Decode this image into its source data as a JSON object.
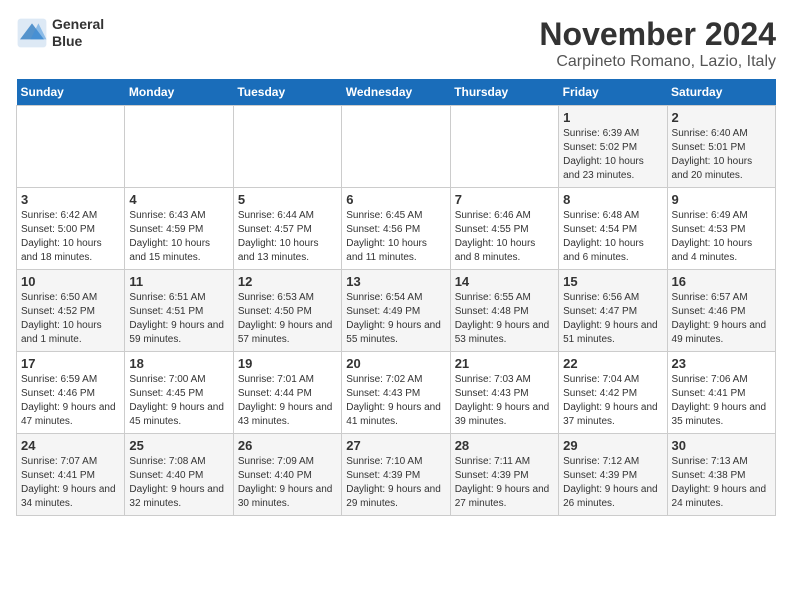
{
  "header": {
    "logo_line1": "General",
    "logo_line2": "Blue",
    "month": "November 2024",
    "location": "Carpineto Romano, Lazio, Italy"
  },
  "weekdays": [
    "Sunday",
    "Monday",
    "Tuesday",
    "Wednesday",
    "Thursday",
    "Friday",
    "Saturday"
  ],
  "weeks": [
    [
      {
        "day": "",
        "info": ""
      },
      {
        "day": "",
        "info": ""
      },
      {
        "day": "",
        "info": ""
      },
      {
        "day": "",
        "info": ""
      },
      {
        "day": "",
        "info": ""
      },
      {
        "day": "1",
        "info": "Sunrise: 6:39 AM\nSunset: 5:02 PM\nDaylight: 10 hours and 23 minutes."
      },
      {
        "day": "2",
        "info": "Sunrise: 6:40 AM\nSunset: 5:01 PM\nDaylight: 10 hours and 20 minutes."
      }
    ],
    [
      {
        "day": "3",
        "info": "Sunrise: 6:42 AM\nSunset: 5:00 PM\nDaylight: 10 hours and 18 minutes."
      },
      {
        "day": "4",
        "info": "Sunrise: 6:43 AM\nSunset: 4:59 PM\nDaylight: 10 hours and 15 minutes."
      },
      {
        "day": "5",
        "info": "Sunrise: 6:44 AM\nSunset: 4:57 PM\nDaylight: 10 hours and 13 minutes."
      },
      {
        "day": "6",
        "info": "Sunrise: 6:45 AM\nSunset: 4:56 PM\nDaylight: 10 hours and 11 minutes."
      },
      {
        "day": "7",
        "info": "Sunrise: 6:46 AM\nSunset: 4:55 PM\nDaylight: 10 hours and 8 minutes."
      },
      {
        "day": "8",
        "info": "Sunrise: 6:48 AM\nSunset: 4:54 PM\nDaylight: 10 hours and 6 minutes."
      },
      {
        "day": "9",
        "info": "Sunrise: 6:49 AM\nSunset: 4:53 PM\nDaylight: 10 hours and 4 minutes."
      }
    ],
    [
      {
        "day": "10",
        "info": "Sunrise: 6:50 AM\nSunset: 4:52 PM\nDaylight: 10 hours and 1 minute."
      },
      {
        "day": "11",
        "info": "Sunrise: 6:51 AM\nSunset: 4:51 PM\nDaylight: 9 hours and 59 minutes."
      },
      {
        "day": "12",
        "info": "Sunrise: 6:53 AM\nSunset: 4:50 PM\nDaylight: 9 hours and 57 minutes."
      },
      {
        "day": "13",
        "info": "Sunrise: 6:54 AM\nSunset: 4:49 PM\nDaylight: 9 hours and 55 minutes."
      },
      {
        "day": "14",
        "info": "Sunrise: 6:55 AM\nSunset: 4:48 PM\nDaylight: 9 hours and 53 minutes."
      },
      {
        "day": "15",
        "info": "Sunrise: 6:56 AM\nSunset: 4:47 PM\nDaylight: 9 hours and 51 minutes."
      },
      {
        "day": "16",
        "info": "Sunrise: 6:57 AM\nSunset: 4:46 PM\nDaylight: 9 hours and 49 minutes."
      }
    ],
    [
      {
        "day": "17",
        "info": "Sunrise: 6:59 AM\nSunset: 4:46 PM\nDaylight: 9 hours and 47 minutes."
      },
      {
        "day": "18",
        "info": "Sunrise: 7:00 AM\nSunset: 4:45 PM\nDaylight: 9 hours and 45 minutes."
      },
      {
        "day": "19",
        "info": "Sunrise: 7:01 AM\nSunset: 4:44 PM\nDaylight: 9 hours and 43 minutes."
      },
      {
        "day": "20",
        "info": "Sunrise: 7:02 AM\nSunset: 4:43 PM\nDaylight: 9 hours and 41 minutes."
      },
      {
        "day": "21",
        "info": "Sunrise: 7:03 AM\nSunset: 4:43 PM\nDaylight: 9 hours and 39 minutes."
      },
      {
        "day": "22",
        "info": "Sunrise: 7:04 AM\nSunset: 4:42 PM\nDaylight: 9 hours and 37 minutes."
      },
      {
        "day": "23",
        "info": "Sunrise: 7:06 AM\nSunset: 4:41 PM\nDaylight: 9 hours and 35 minutes."
      }
    ],
    [
      {
        "day": "24",
        "info": "Sunrise: 7:07 AM\nSunset: 4:41 PM\nDaylight: 9 hours and 34 minutes."
      },
      {
        "day": "25",
        "info": "Sunrise: 7:08 AM\nSunset: 4:40 PM\nDaylight: 9 hours and 32 minutes."
      },
      {
        "day": "26",
        "info": "Sunrise: 7:09 AM\nSunset: 4:40 PM\nDaylight: 9 hours and 30 minutes."
      },
      {
        "day": "27",
        "info": "Sunrise: 7:10 AM\nSunset: 4:39 PM\nDaylight: 9 hours and 29 minutes."
      },
      {
        "day": "28",
        "info": "Sunrise: 7:11 AM\nSunset: 4:39 PM\nDaylight: 9 hours and 27 minutes."
      },
      {
        "day": "29",
        "info": "Sunrise: 7:12 AM\nSunset: 4:39 PM\nDaylight: 9 hours and 26 minutes."
      },
      {
        "day": "30",
        "info": "Sunrise: 7:13 AM\nSunset: 4:38 PM\nDaylight: 9 hours and 24 minutes."
      }
    ]
  ]
}
